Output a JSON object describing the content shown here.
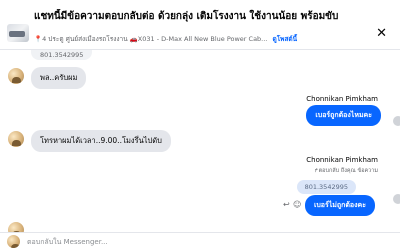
{
  "header": {
    "title": "แชทนี้มีข้อความตอบกลับต่อ ด้วยกลุ่ง เติมโรงงาน ใช้งานน้อย พร้อมขับ",
    "subtitle": "📍4 ประตู ศูนย์ส่งเมืองรถโรงงาน 🚗X031 - D-Max All New Blue Power Cab...",
    "link": "ดูโพสต์นี้",
    "close_icon": "close-icon"
  },
  "messages": {
    "top_partial": "801.3542995",
    "m1": "พล..ครับผม",
    "sender1": "Chonnikan Pimkham",
    "out1": "เบอร์ถูกต้องไหมคะ",
    "m2": "โทรหาผมได้เวลา..9.00..โมงรึ่นไปดับ",
    "sender2": "Chonnikan Pimkham",
    "reply_note": "↱ตอบกลับ ถึงคุณ ข้อความ",
    "quoted": "801.3542995",
    "out2": "เบอร์ไม่ถูกต้องคะ"
  },
  "composer": {
    "placeholder": "ตอบกลับใน Messenger..."
  },
  "colors": {
    "accent": "#0866ff",
    "incoming_bubble": "#e4e6eb",
    "text": "#050505",
    "muted": "#65676b"
  }
}
